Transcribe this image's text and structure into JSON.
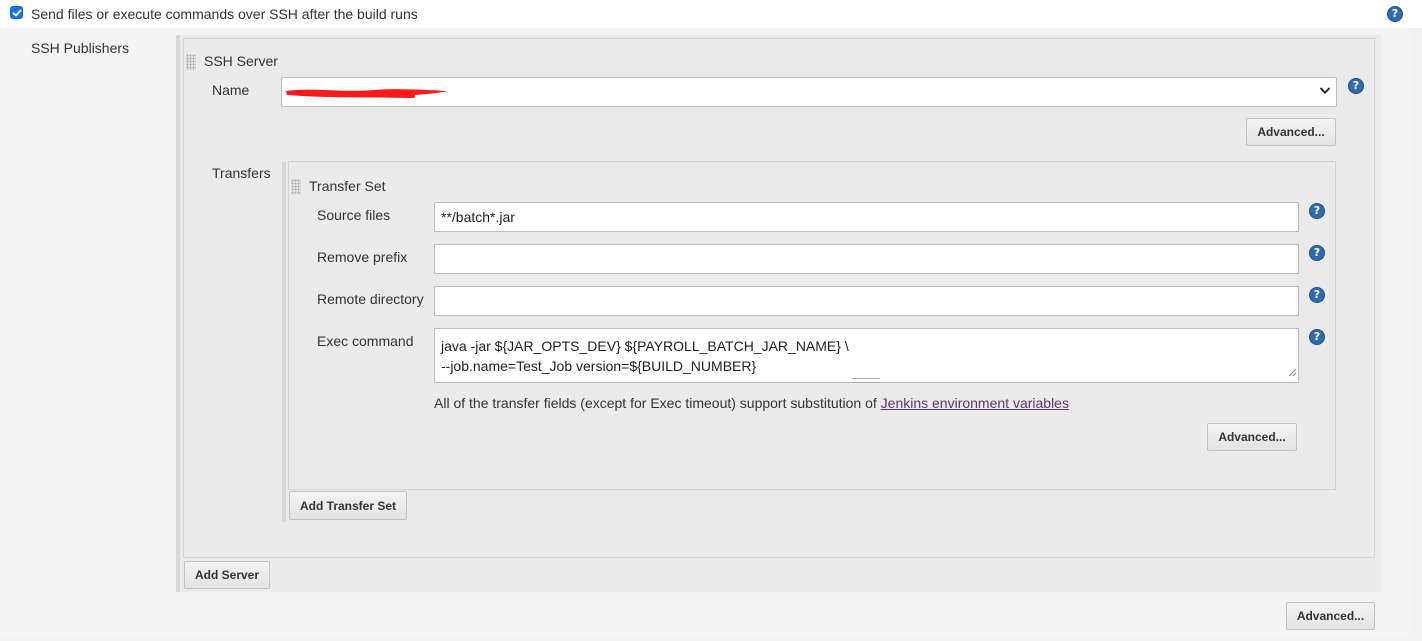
{
  "header": {
    "checkbox_checked": true,
    "checkbox_label": "Send files or execute commands over SSH after the build runs"
  },
  "publishers": {
    "label": "SSH Publishers",
    "add_server_label": "Add Server",
    "advanced_label": "Advanced..."
  },
  "server": {
    "section_title": "SSH Server",
    "name_label": "Name",
    "name_value_redacted": true,
    "advanced_label": "Advanced..."
  },
  "transfers": {
    "label": "Transfers",
    "add_transfer_set_label": "Add Transfer Set",
    "transfer_set": {
      "title": "Transfer Set",
      "source_files_label": "Source files",
      "source_files_value": "**/batch*.jar",
      "remove_prefix_label": "Remove prefix",
      "remove_prefix_value": "",
      "remote_directory_label": "Remote directory",
      "remote_directory_value": "",
      "exec_command_label": "Exec command",
      "exec_command_value": "java -jar ${JAR_OPTS_DEV} ${PAYROLL_BATCH_JAR_NAME} \\\n--job.name=Test_Job version=${BUILD_NUMBER}",
      "note_text": "All of the transfer fields (except for Exec timeout) support substitution of ",
      "note_link": "Jenkins environment variables",
      "advanced_label": "Advanced..."
    }
  },
  "icons": {
    "help": "help-question-icon",
    "check": "checkmark-icon",
    "chevron": "chevron-down-icon",
    "handle": "drag-handle-icon"
  },
  "colors": {
    "checkbox": "#1a73e8",
    "help_icon": "#2f6bb0",
    "link": "#5c3566",
    "redaction": "#ff1a1a"
  }
}
